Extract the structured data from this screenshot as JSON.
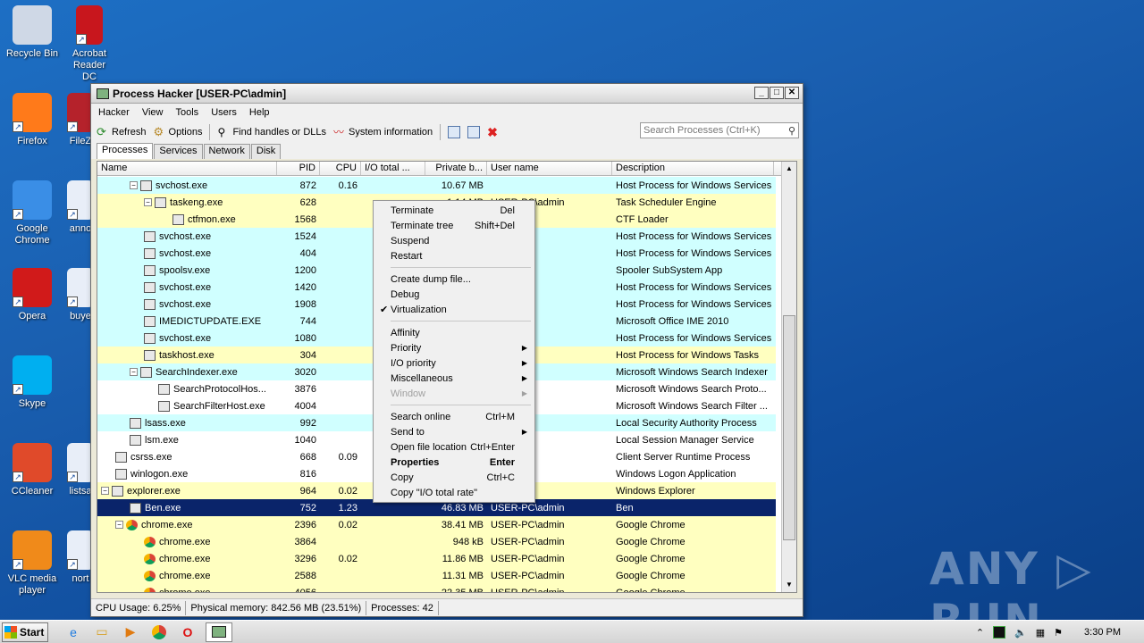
{
  "desktop": {
    "icons": [
      {
        "label": "Recycle Bin",
        "icon": "recycle-bin-icon"
      },
      {
        "label": "Acrobat Reader DC",
        "icon": "acrobat-icon"
      },
      {
        "label": "Firefox",
        "icon": "firefox-icon"
      },
      {
        "label": "FileZ",
        "icon": "filezilla-icon"
      },
      {
        "label": "Google Chrome",
        "icon": "chrome-icon"
      },
      {
        "label": "anno",
        "icon": "word-doc-icon"
      },
      {
        "label": "Opera",
        "icon": "opera-icon"
      },
      {
        "label": "buye",
        "icon": "word-doc-icon"
      },
      {
        "label": "Skype",
        "icon": "skype-icon"
      },
      {
        "label": "CCleaner",
        "icon": "ccleaner-icon"
      },
      {
        "label": "listsa",
        "icon": "word-doc-icon"
      },
      {
        "label": "VLC media player",
        "icon": "vlc-icon"
      },
      {
        "label": "nort",
        "icon": "word-doc-icon"
      }
    ],
    "watermark": "ANY ▷ RUN"
  },
  "window": {
    "title": "Process Hacker [USER-PC\\admin]",
    "menu": [
      "Hacker",
      "View",
      "Tools",
      "Users",
      "Help"
    ],
    "toolbar": {
      "refresh": "Refresh",
      "options": "Options",
      "find": "Find handles or DLLs",
      "sysinfo": "System information"
    },
    "search_placeholder": "Search Processes (Ctrl+K)",
    "tabs": [
      "Processes",
      "Services",
      "Network",
      "Disk"
    ],
    "columns": [
      "Name",
      "PID",
      "CPU",
      "I/O total ...",
      "Private b...",
      "User name",
      "Description"
    ],
    "rows": [
      {
        "name": "svchost.exe",
        "pid": "872",
        "cpu": "0.16",
        "io": "",
        "priv": "10.67 MB",
        "user": "",
        "desc": "Host Process for Windows Services",
        "color": "c-svc",
        "indent": 2,
        "exp": "−"
      },
      {
        "name": "taskeng.exe",
        "pid": "628",
        "cpu": "",
        "io": "",
        "priv": "1.14 MB",
        "user": "USER-PC\\admin",
        "desc": "Task Scheduler Engine",
        "color": "c-own",
        "indent": 3,
        "exp": "−"
      },
      {
        "name": "ctfmon.exe",
        "pid": "1568",
        "cpu": "",
        "io": "",
        "priv": "",
        "user": "admin",
        "desc": "CTF Loader",
        "color": "c-own",
        "indent": 5,
        "exp": ""
      },
      {
        "name": "svchost.exe",
        "pid": "1524",
        "cpu": "",
        "io": "",
        "priv": "",
        "user": "",
        "desc": "Host Process for Windows Services",
        "color": "c-svc",
        "indent": 3,
        "exp": ""
      },
      {
        "name": "svchost.exe",
        "pid": "404",
        "cpu": "",
        "io": "",
        "priv": "",
        "user": "",
        "desc": "Host Process for Windows Services",
        "color": "c-svc",
        "indent": 3,
        "exp": ""
      },
      {
        "name": "spoolsv.exe",
        "pid": "1200",
        "cpu": "",
        "io": "",
        "priv": "",
        "user": "",
        "desc": "Spooler SubSystem App",
        "color": "c-svc",
        "indent": 3,
        "exp": ""
      },
      {
        "name": "svchost.exe",
        "pid": "1420",
        "cpu": "",
        "io": "",
        "priv": "",
        "user": "",
        "desc": "Host Process for Windows Services",
        "color": "c-svc",
        "indent": 3,
        "exp": ""
      },
      {
        "name": "svchost.exe",
        "pid": "1908",
        "cpu": "",
        "io": "",
        "priv": "",
        "user": "",
        "desc": "Host Process for Windows Services",
        "color": "c-svc",
        "indent": 3,
        "exp": ""
      },
      {
        "name": "IMEDICTUPDATE.EXE",
        "pid": "744",
        "cpu": "",
        "io": "",
        "priv": "",
        "user": "",
        "desc": "Microsoft Office IME 2010",
        "color": "c-svc",
        "indent": 3,
        "exp": ""
      },
      {
        "name": "svchost.exe",
        "pid": "1080",
        "cpu": "",
        "io": "",
        "priv": "",
        "user": "",
        "desc": "Host Process for Windows Services",
        "color": "c-svc",
        "indent": 3,
        "exp": ""
      },
      {
        "name": "taskhost.exe",
        "pid": "304",
        "cpu": "",
        "io": "",
        "priv": "",
        "user": "admin",
        "desc": "Host Process for Windows Tasks",
        "color": "c-own",
        "indent": 3,
        "exp": ""
      },
      {
        "name": "SearchIndexer.exe",
        "pid": "3020",
        "cpu": "",
        "io": "",
        "priv": "",
        "user": "",
        "desc": "Microsoft Windows Search Indexer",
        "color": "c-svc",
        "indent": 2,
        "exp": "−"
      },
      {
        "name": "SearchProtocolHos...",
        "pid": "3876",
        "cpu": "",
        "io": "",
        "priv": "",
        "user": "",
        "desc": "Microsoft Windows Search Proto...",
        "color": "c-sys",
        "indent": 4,
        "exp": ""
      },
      {
        "name": "SearchFilterHost.exe",
        "pid": "4004",
        "cpu": "",
        "io": "",
        "priv": "",
        "user": "",
        "desc": "Microsoft Windows Search Filter ...",
        "color": "c-sys",
        "indent": 4,
        "exp": ""
      },
      {
        "name": "lsass.exe",
        "pid": "992",
        "cpu": "",
        "io": "",
        "priv": "",
        "user": "",
        "desc": "Local Security Authority Process",
        "color": "c-svc",
        "indent": 2,
        "exp": ""
      },
      {
        "name": "lsm.exe",
        "pid": "1040",
        "cpu": "",
        "io": "",
        "priv": "",
        "user": "",
        "desc": "Local Session Manager Service",
        "color": "c-sys",
        "indent": 2,
        "exp": ""
      },
      {
        "name": "csrss.exe",
        "pid": "668",
        "cpu": "0.09",
        "io": "",
        "priv": "",
        "user": "",
        "desc": "Client Server Runtime Process",
        "color": "c-sys",
        "indent": 1,
        "exp": ""
      },
      {
        "name": "winlogon.exe",
        "pid": "816",
        "cpu": "",
        "io": "",
        "priv": "",
        "user": "",
        "desc": "Windows Logon Application",
        "color": "c-sys",
        "indent": 1,
        "exp": ""
      },
      {
        "name": "explorer.exe",
        "pid": "964",
        "cpu": "0.02",
        "io": "",
        "priv": "",
        "user": "admin",
        "desc": "Windows Explorer",
        "color": "c-own",
        "indent": 0,
        "exp": "−"
      },
      {
        "name": "Ben.exe",
        "pid": "752",
        "cpu": "1.23",
        "io": "",
        "priv": "46.83 MB",
        "user": "USER-PC\\admin",
        "desc": "Ben",
        "color": "c-sel",
        "indent": 2,
        "exp": ""
      },
      {
        "name": "chrome.exe",
        "pid": "2396",
        "cpu": "0.02",
        "io": "",
        "priv": "38.41 MB",
        "user": "USER-PC\\admin",
        "desc": "Google Chrome",
        "color": "c-own",
        "indent": 1,
        "exp": "−",
        "chrome": true
      },
      {
        "name": "chrome.exe",
        "pid": "3864",
        "cpu": "",
        "io": "",
        "priv": "948 kB",
        "user": "USER-PC\\admin",
        "desc": "Google Chrome",
        "color": "c-own",
        "indent": 3,
        "exp": "",
        "chrome": true
      },
      {
        "name": "chrome.exe",
        "pid": "3296",
        "cpu": "0.02",
        "io": "",
        "priv": "11.86 MB",
        "user": "USER-PC\\admin",
        "desc": "Google Chrome",
        "color": "c-own",
        "indent": 3,
        "exp": "",
        "chrome": true
      },
      {
        "name": "chrome.exe",
        "pid": "2588",
        "cpu": "",
        "io": "",
        "priv": "11.31 MB",
        "user": "USER-PC\\admin",
        "desc": "Google Chrome",
        "color": "c-own",
        "indent": 3,
        "exp": "",
        "chrome": true
      },
      {
        "name": "chrome.exe",
        "pid": "4056",
        "cpu": "",
        "io": "",
        "priv": "22.35 MB",
        "user": "USER-PC\\admin",
        "desc": "Google Chrome",
        "color": "c-own",
        "indent": 3,
        "exp": "",
        "chrome": true
      }
    ],
    "status": {
      "cpu": "CPU Usage: 6.25%",
      "mem": "Physical memory: 842.56 MB (23.51%)",
      "procs": "Processes: 42"
    }
  },
  "context_menu": {
    "groups": [
      [
        {
          "label": "Terminate",
          "shortcut": "Del"
        },
        {
          "label": "Terminate tree",
          "shortcut": "Shift+Del"
        },
        {
          "label": "Suspend",
          "shortcut": ""
        },
        {
          "label": "Restart",
          "shortcut": ""
        }
      ],
      [
        {
          "label": "Create dump file...",
          "shortcut": ""
        },
        {
          "label": "Debug",
          "shortcut": ""
        },
        {
          "label": "Virtualization",
          "shortcut": "",
          "checked": true
        }
      ],
      [
        {
          "label": "Affinity",
          "shortcut": ""
        },
        {
          "label": "Priority",
          "shortcut": "",
          "submenu": true
        },
        {
          "label": "I/O priority",
          "shortcut": "",
          "submenu": true
        },
        {
          "label": "Miscellaneous",
          "shortcut": "",
          "submenu": true
        },
        {
          "label": "Window",
          "shortcut": "",
          "submenu": true,
          "disabled": true
        }
      ],
      [
        {
          "label": "Search online",
          "shortcut": "Ctrl+M"
        },
        {
          "label": "Send to",
          "shortcut": "",
          "submenu": true
        },
        {
          "label": "Open file location",
          "shortcut": "Ctrl+Enter"
        },
        {
          "label": "Properties",
          "shortcut": "Enter",
          "bold": true
        },
        {
          "label": "Copy",
          "shortcut": "Ctrl+C"
        },
        {
          "label": "Copy \"I/O total rate\"",
          "shortcut": ""
        }
      ]
    ]
  },
  "taskbar": {
    "start_label": "Start",
    "clock": "3:30 PM"
  }
}
